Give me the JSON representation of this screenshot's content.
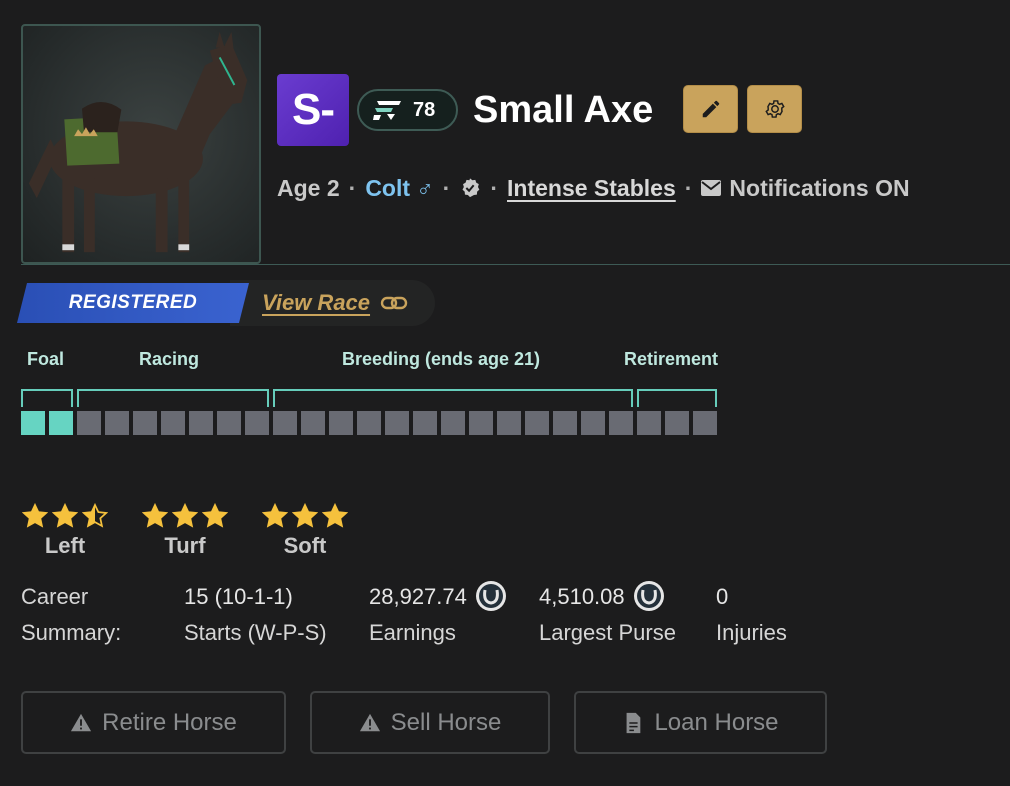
{
  "horse": {
    "name": "Small Axe",
    "grade": "S-",
    "rating": "78",
    "age": "Age 2",
    "sex": "Colt ♂",
    "stable": "Intense Stables",
    "notifications": "Notifications ON"
  },
  "status": {
    "tag": "REGISTERED",
    "link": "View Race"
  },
  "lifecycle": {
    "labels": [
      "Foal",
      "Racing",
      "Breeding (ends age 21)",
      "Retirement"
    ],
    "total_cells": 25,
    "completed_cells": 2,
    "colors": {
      "active": "#66d4c2",
      "inactive": "#696b73",
      "bracket": "#66cdbb"
    }
  },
  "ratings": [
    {
      "label": "Left",
      "stars": 2.5
    },
    {
      "label": "Turf",
      "stars": 3
    },
    {
      "label": "Soft",
      "stars": 3
    }
  ],
  "career": {
    "title_line1": "Career",
    "title_line2": "Summary:",
    "starts_value": "15 (10-1-1)",
    "starts_label": "Starts (W-P-S)",
    "earnings_value": "28,927.74",
    "earnings_label": "Earnings",
    "largest_purse_value": "4,510.08",
    "largest_purse_label": "Largest Purse",
    "injuries_value": "0",
    "injuries_label": "Injuries"
  },
  "actions": {
    "retire": "Retire Horse",
    "sell": "Sell Horse",
    "loan": "Loan Horse"
  },
  "colors": {
    "accent_gold": "#c9a35c",
    "grade_purple": "#5a2cc0",
    "registered_blue": "#3a63d0",
    "colt_blue": "#7ec3ef",
    "star_yellow": "#f5c13d"
  },
  "icons": {
    "edit": "pencil-icon",
    "settings": "gear-icon",
    "mail": "envelope-icon",
    "verified": "verified-badge-icon",
    "link": "chain-link-icon",
    "warning": "warning-icon",
    "document": "document-icon",
    "currency": "horseshoe-coin-icon"
  }
}
